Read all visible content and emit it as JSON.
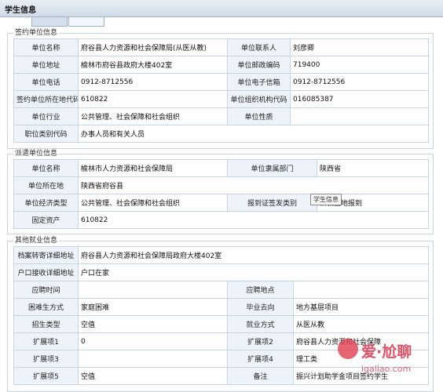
{
  "window": {
    "title": "学生信息"
  },
  "tabs": [
    "",
    ""
  ],
  "sections": [
    {
      "title": "签约单位信息",
      "rows": [
        [
          "单位名称",
          "府谷县人力资源和社会保障局(从医从教)",
          "单位联系人",
          "刘彦卿"
        ],
        [
          "单位地址",
          "榆林市府谷县政府大楼402室",
          "单位邮政编码",
          "719400"
        ],
        [
          "单位电话",
          "0912-8712556",
          "单位电子信箱",
          "0912-8712556"
        ],
        [
          "签约单位所在地代码",
          "610822",
          "单位组织机构代码",
          "016085387"
        ],
        [
          "单位行业",
          "公共管理、社会保障和社会组织",
          "单位性质",
          ""
        ],
        [
          "职位类别代码",
          "办事人员和有关人员",
          "",
          ""
        ]
      ]
    },
    {
      "title": "派遣单位信息",
      "rows": [
        [
          "单位名称",
          "榆林市人力资源和社会保障局",
          "单位隶属部门",
          "陕西省"
        ],
        [
          "单位所在地",
          "陕西省府谷县",
          "",
          ""
        ],
        [
          "单位经济类型",
          "公共管理、社会保障和社会组织",
          "报到证签发类别",
          "去就业地报到"
        ],
        [
          "固定资产",
          "610822",
          "",
          ""
        ]
      ]
    },
    {
      "title": "其他就业信息",
      "rows": [
        [
          "档案转寄详细地址",
          "府谷县人力资源和社会保障局政府大楼402室",
          "",
          ""
        ],
        [
          "户口接收详细地址",
          "户口在家",
          "",
          ""
        ],
        [
          "应聘时间",
          "",
          "应聘地点",
          ""
        ],
        [
          "困难生方式",
          "家庭困难",
          "毕业去向",
          "地方基层项目"
        ],
        [
          "招生类型",
          "空值",
          "就业方式",
          "从医从教"
        ],
        [
          "扩展项1",
          "0",
          "扩展项2",
          "府谷县人力资源和社会保障"
        ],
        [
          "扩展项3",
          "",
          "扩展项4",
          "理工类"
        ],
        [
          "扩展项5",
          "空值",
          "备注",
          "振兴计划助学金项目签约学生"
        ]
      ]
    }
  ],
  "tooltip": "学生信息",
  "watermark": {
    "brand": "爱·尬聊",
    "url": "igaliao.com",
    "color": "#d8354b"
  }
}
